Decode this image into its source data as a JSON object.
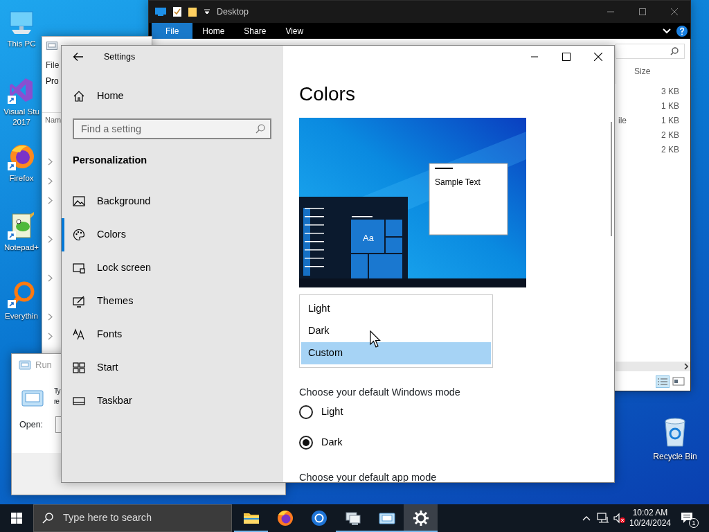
{
  "desktop_icons": [
    {
      "kind": "pc",
      "lines": [
        "This PC"
      ]
    },
    {
      "kind": "visual-studio",
      "lines": [
        "Visual Stu",
        "2017"
      ]
    },
    {
      "kind": "firefox",
      "lines": [
        "Firefox"
      ]
    },
    {
      "kind": "notepad",
      "lines": [
        "Notepad+"
      ]
    },
    {
      "kind": "magnifier",
      "lines": [
        "Everythin"
      ]
    }
  ],
  "recycle_bin": {
    "label": "Recycle Bin"
  },
  "explorer": {
    "title": "Desktop",
    "ribbon_tabs": [
      {
        "label": "File",
        "selected": true
      },
      {
        "label": "Home",
        "selected": false
      },
      {
        "label": "Share",
        "selected": false
      },
      {
        "label": "View",
        "selected": false
      }
    ],
    "column_header": "Size",
    "rows": [
      {
        "type_cut": "",
        "size": "3 KB"
      },
      {
        "type_cut": "",
        "size": "1 KB"
      },
      {
        "type_cut": "ile",
        "size": "1 KB"
      },
      {
        "type_cut": "",
        "size": "2 KB"
      },
      {
        "type_cut": "",
        "size": "2 KB"
      }
    ]
  },
  "back_window": {
    "menu": "File",
    "crumb": "Pro",
    "column": "Nam",
    "tree": [
      {
        "has_children": true
      },
      {
        "has_children": true
      },
      {
        "has_children": true
      },
      {
        "has_children": false
      },
      {
        "has_children": true
      },
      {
        "has_children": false
      },
      {
        "has_children": true
      },
      {
        "has_children": false
      },
      {
        "has_children": true
      },
      {
        "has_children": true
      }
    ]
  },
  "run": {
    "title": "Run",
    "text_lines": [
      "Ty",
      "re"
    ],
    "open_label": "Open:"
  },
  "settings": {
    "title": "Settings",
    "home": "Home",
    "search_placeholder": "Find a setting",
    "section": "Personalization",
    "nav": [
      {
        "kind": "background",
        "label": "Background",
        "selected": false
      },
      {
        "kind": "colors",
        "label": "Colors",
        "selected": true
      },
      {
        "kind": "lock-screen",
        "label": "Lock screen",
        "selected": false
      },
      {
        "kind": "themes",
        "label": "Themes",
        "selected": false
      },
      {
        "kind": "fonts",
        "label": "Fonts",
        "selected": false
      },
      {
        "kind": "start",
        "label": "Start",
        "selected": false
      },
      {
        "kind": "taskbar",
        "label": "Taskbar",
        "selected": false
      }
    ],
    "page_title": "Colors",
    "preview": {
      "sample_text": "Sample Text",
      "tile_text": "Aa"
    },
    "dropdown": [
      {
        "label": "Light",
        "selected": false
      },
      {
        "label": "Dark",
        "selected": false
      },
      {
        "label": "Custom",
        "selected": true
      }
    ],
    "windows_mode": {
      "label": "Choose your default Windows mode",
      "options": [
        {
          "label": "Light",
          "selected": false
        },
        {
          "label": "Dark",
          "selected": true
        }
      ]
    },
    "app_mode_label": "Choose your default app mode"
  },
  "taskbar": {
    "search_placeholder": "Type here to search",
    "apps": [
      {
        "kind": "folder",
        "running": true,
        "selected": false
      },
      {
        "kind": "firefox",
        "running": false,
        "selected": false
      },
      {
        "kind": "browser",
        "running": false,
        "selected": false
      },
      {
        "kind": "monitors",
        "running": true,
        "selected": false
      },
      {
        "kind": "run",
        "running": true,
        "selected": false
      },
      {
        "kind": "settings",
        "running": true,
        "selected": true
      }
    ],
    "time": "10:02 AM",
    "date": "10/24/2024",
    "notification_count": "1"
  }
}
